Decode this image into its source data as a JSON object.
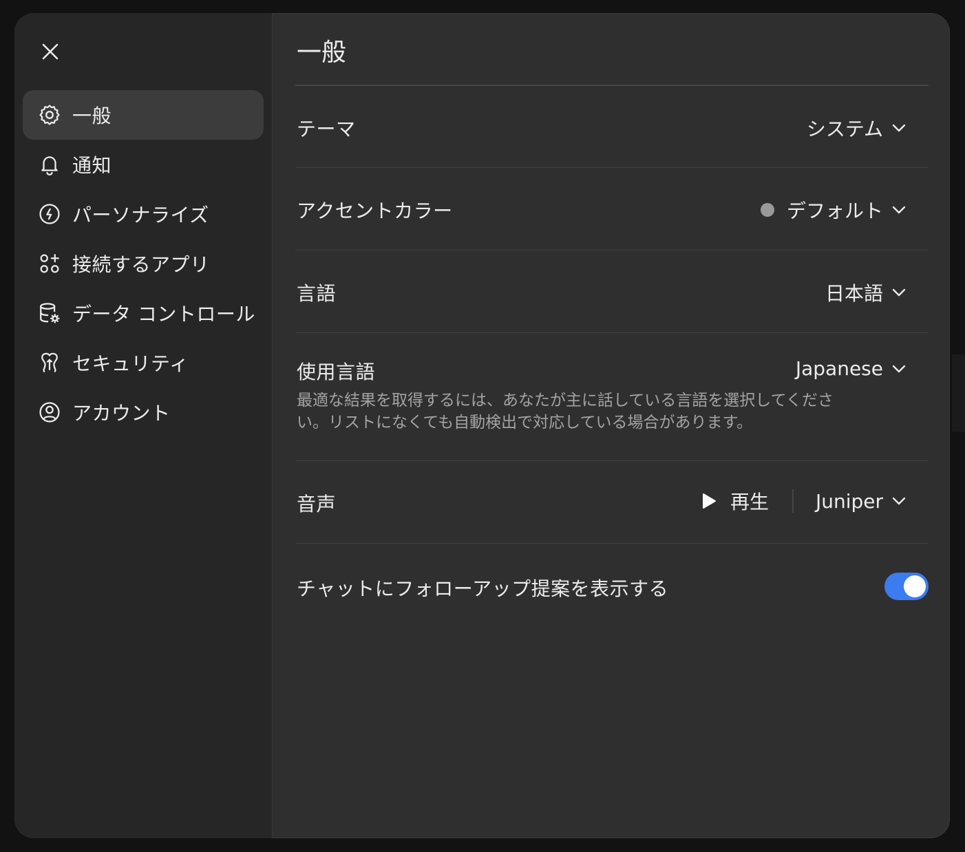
{
  "sidebar": {
    "close_icon": "close-icon",
    "items": [
      {
        "label": "一般",
        "icon": "gear-icon",
        "active": true
      },
      {
        "label": "通知",
        "icon": "bell-icon",
        "active": false
      },
      {
        "label": "パーソナライズ",
        "icon": "personalize-icon",
        "active": false
      },
      {
        "label": "接続するアプリ",
        "icon": "apps-icon",
        "active": false
      },
      {
        "label": "データ コントロール",
        "icon": "data-control-icon",
        "active": false
      },
      {
        "label": "セキュリティ",
        "icon": "security-icon",
        "active": false
      },
      {
        "label": "アカウント",
        "icon": "account-icon",
        "active": false
      }
    ]
  },
  "main": {
    "title": "一般",
    "settings": {
      "theme": {
        "label": "テーマ",
        "value": "システム"
      },
      "accent": {
        "label": "アクセントカラー",
        "value": "デフォルト",
        "dot_color": "#9a9a9a"
      },
      "language": {
        "label": "言語",
        "value": "日本語"
      },
      "spoken_language": {
        "label": "使用言語",
        "value": "Japanese",
        "help": "最適な結果を取得するには、あなたが主に話している言語を選択してください。リストになくても自動検出で対応している場合があります。"
      },
      "voice": {
        "label": "音声",
        "play_label": "再生",
        "value": "Juniper"
      },
      "followup": {
        "label": "チャットにフォローアップ提案を表示する",
        "enabled": true,
        "toggle_color": "#3b7cf1"
      }
    }
  }
}
